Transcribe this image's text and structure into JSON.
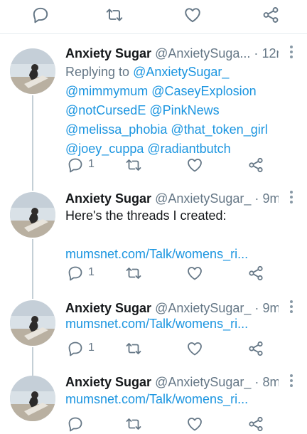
{
  "colors": {
    "accent": "#1b95e0",
    "muted": "#657786",
    "icon": "#657786"
  },
  "top_actions": [
    "reply-icon",
    "retweet-icon",
    "like-icon",
    "share-icon"
  ],
  "tweets": [
    {
      "name": "Anxiety Sugar",
      "handle": "@AnxietySuga...",
      "dot": "·",
      "time": "12m",
      "replying_prefix": "Replying to ",
      "replying_lines": [
        "@AnxietySugar_",
        "@mimmymum @CaseyExplosion",
        "@notCursedE @PinkNews",
        "@melissa_phobia @that_token_girl",
        "@joey_cuppa @radiantbutch"
      ],
      "reply_count": "1"
    },
    {
      "name": "Anxiety Sugar",
      "handle": "@AnxietySugar_",
      "dot": "·",
      "time": "9m",
      "text": "Here's the threads I created:",
      "link": "mumsnet.com/Talk/womens_ri...",
      "reply_count": "1"
    },
    {
      "name": "Anxiety Sugar",
      "handle": "@AnxietySugar_",
      "dot": "·",
      "time": "9m",
      "link": "mumsnet.com/Talk/womens_ri...",
      "reply_count": "1"
    },
    {
      "name": "Anxiety Sugar",
      "handle": "@AnxietySugar_",
      "dot": "·",
      "time": "8m",
      "link": "mumsnet.com/Talk/womens_ri..."
    }
  ]
}
